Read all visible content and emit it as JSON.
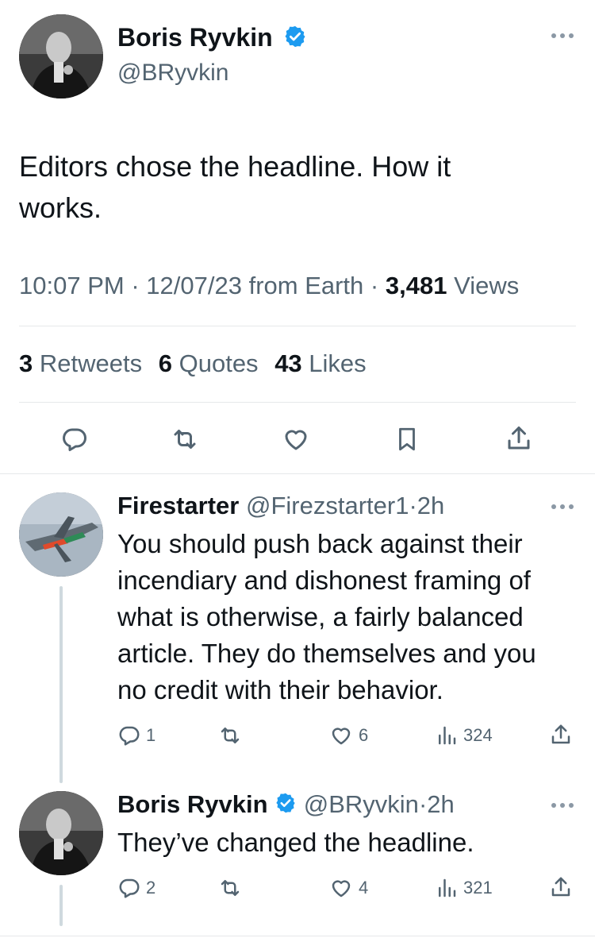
{
  "main_tweet": {
    "author_name": "Boris Ryvkin",
    "author_handle": "@BRyvkin",
    "text_line1": "Editors chose the headline. How it",
    "text_line2": "works.",
    "time": "10:07 PM",
    "date": "12/07/23",
    "source": "from Earth",
    "views_count": "3,481",
    "views_label": "Views",
    "retweets_count": "3",
    "retweets_label": "Retweets",
    "quotes_count": "6",
    "quotes_label": "Quotes",
    "likes_count": "43",
    "likes_label": "Likes"
  },
  "replies": [
    {
      "author_name": "Firestarter",
      "author_handle": "@Firezstarter1",
      "age": "2h",
      "lines": [
        "You should push back against their",
        "incendiary and dishonest framing of",
        "what is otherwise, a fairly balanced",
        "article. They do themselves and you",
        "no credit with their behavior."
      ],
      "replies": "1",
      "likes": "6",
      "views": "324"
    },
    {
      "author_name": "Boris Ryvkin",
      "author_handle": "@BRyvkin",
      "age": "2h",
      "lines": [
        "They’ve changed the headline."
      ],
      "replies": "2",
      "likes": "4",
      "views": "321"
    }
  ],
  "separator": "·",
  "icons": {
    "verified": "verified-badge-icon",
    "more": "more-icon",
    "reply": "reply-icon",
    "retweet": "retweet-icon",
    "like": "like-icon",
    "bookmark": "bookmark-icon",
    "share": "share-icon",
    "views": "views-icon"
  },
  "colors": {
    "verified": "#1d9bf0",
    "muted": "#536471",
    "text": "#0f1419"
  }
}
